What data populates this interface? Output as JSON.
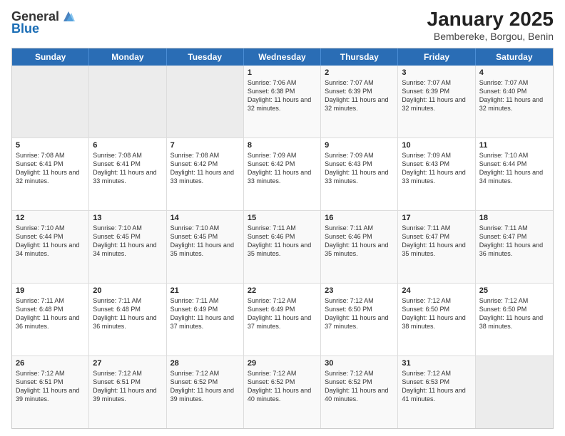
{
  "logo": {
    "general": "General",
    "blue": "Blue"
  },
  "header": {
    "month": "January 2025",
    "location": "Bembereke, Borgou, Benin"
  },
  "days": [
    "Sunday",
    "Monday",
    "Tuesday",
    "Wednesday",
    "Thursday",
    "Friday",
    "Saturday"
  ],
  "weeks": [
    [
      {
        "day": "",
        "sun": "",
        "mon": "",
        "rise": "",
        "set": "",
        "daylight": ""
      },
      {
        "day": "",
        "empty": true
      },
      {
        "day": "",
        "empty": true
      },
      {
        "day": "1",
        "rise": "Sunrise: 7:06 AM",
        "set": "Sunset: 6:38 PM",
        "daylight": "Daylight: 11 hours and 32 minutes."
      },
      {
        "day": "2",
        "rise": "Sunrise: 7:07 AM",
        "set": "Sunset: 6:39 PM",
        "daylight": "Daylight: 11 hours and 32 minutes."
      },
      {
        "day": "3",
        "rise": "Sunrise: 7:07 AM",
        "set": "Sunset: 6:39 PM",
        "daylight": "Daylight: 11 hours and 32 minutes."
      },
      {
        "day": "4",
        "rise": "Sunrise: 7:07 AM",
        "set": "Sunset: 6:40 PM",
        "daylight": "Daylight: 11 hours and 32 minutes."
      }
    ],
    [
      {
        "day": "5",
        "rise": "Sunrise: 7:08 AM",
        "set": "Sunset: 6:41 PM",
        "daylight": "Daylight: 11 hours and 32 minutes."
      },
      {
        "day": "6",
        "rise": "Sunrise: 7:08 AM",
        "set": "Sunset: 6:41 PM",
        "daylight": "Daylight: 11 hours and 33 minutes."
      },
      {
        "day": "7",
        "rise": "Sunrise: 7:08 AM",
        "set": "Sunset: 6:42 PM",
        "daylight": "Daylight: 11 hours and 33 minutes."
      },
      {
        "day": "8",
        "rise": "Sunrise: 7:09 AM",
        "set": "Sunset: 6:42 PM",
        "daylight": "Daylight: 11 hours and 33 minutes."
      },
      {
        "day": "9",
        "rise": "Sunrise: 7:09 AM",
        "set": "Sunset: 6:43 PM",
        "daylight": "Daylight: 11 hours and 33 minutes."
      },
      {
        "day": "10",
        "rise": "Sunrise: 7:09 AM",
        "set": "Sunset: 6:43 PM",
        "daylight": "Daylight: 11 hours and 33 minutes."
      },
      {
        "day": "11",
        "rise": "Sunrise: 7:10 AM",
        "set": "Sunset: 6:44 PM",
        "daylight": "Daylight: 11 hours and 34 minutes."
      }
    ],
    [
      {
        "day": "12",
        "rise": "Sunrise: 7:10 AM",
        "set": "Sunset: 6:44 PM",
        "daylight": "Daylight: 11 hours and 34 minutes."
      },
      {
        "day": "13",
        "rise": "Sunrise: 7:10 AM",
        "set": "Sunset: 6:45 PM",
        "daylight": "Daylight: 11 hours and 34 minutes."
      },
      {
        "day": "14",
        "rise": "Sunrise: 7:10 AM",
        "set": "Sunset: 6:45 PM",
        "daylight": "Daylight: 11 hours and 35 minutes."
      },
      {
        "day": "15",
        "rise": "Sunrise: 7:11 AM",
        "set": "Sunset: 6:46 PM",
        "daylight": "Daylight: 11 hours and 35 minutes."
      },
      {
        "day": "16",
        "rise": "Sunrise: 7:11 AM",
        "set": "Sunset: 6:46 PM",
        "daylight": "Daylight: 11 hours and 35 minutes."
      },
      {
        "day": "17",
        "rise": "Sunrise: 7:11 AM",
        "set": "Sunset: 6:47 PM",
        "daylight": "Daylight: 11 hours and 35 minutes."
      },
      {
        "day": "18",
        "rise": "Sunrise: 7:11 AM",
        "set": "Sunset: 6:47 PM",
        "daylight": "Daylight: 11 hours and 36 minutes."
      }
    ],
    [
      {
        "day": "19",
        "rise": "Sunrise: 7:11 AM",
        "set": "Sunset: 6:48 PM",
        "daylight": "Daylight: 11 hours and 36 minutes."
      },
      {
        "day": "20",
        "rise": "Sunrise: 7:11 AM",
        "set": "Sunset: 6:48 PM",
        "daylight": "Daylight: 11 hours and 36 minutes."
      },
      {
        "day": "21",
        "rise": "Sunrise: 7:11 AM",
        "set": "Sunset: 6:49 PM",
        "daylight": "Daylight: 11 hours and 37 minutes."
      },
      {
        "day": "22",
        "rise": "Sunrise: 7:12 AM",
        "set": "Sunset: 6:49 PM",
        "daylight": "Daylight: 11 hours and 37 minutes."
      },
      {
        "day": "23",
        "rise": "Sunrise: 7:12 AM",
        "set": "Sunset: 6:50 PM",
        "daylight": "Daylight: 11 hours and 37 minutes."
      },
      {
        "day": "24",
        "rise": "Sunrise: 7:12 AM",
        "set": "Sunset: 6:50 PM",
        "daylight": "Daylight: 11 hours and 38 minutes."
      },
      {
        "day": "25",
        "rise": "Sunrise: 7:12 AM",
        "set": "Sunset: 6:50 PM",
        "daylight": "Daylight: 11 hours and 38 minutes."
      }
    ],
    [
      {
        "day": "26",
        "rise": "Sunrise: 7:12 AM",
        "set": "Sunset: 6:51 PM",
        "daylight": "Daylight: 11 hours and 39 minutes."
      },
      {
        "day": "27",
        "rise": "Sunrise: 7:12 AM",
        "set": "Sunset: 6:51 PM",
        "daylight": "Daylight: 11 hours and 39 minutes."
      },
      {
        "day": "28",
        "rise": "Sunrise: 7:12 AM",
        "set": "Sunset: 6:52 PM",
        "daylight": "Daylight: 11 hours and 39 minutes."
      },
      {
        "day": "29",
        "rise": "Sunrise: 7:12 AM",
        "set": "Sunset: 6:52 PM",
        "daylight": "Daylight: 11 hours and 40 minutes."
      },
      {
        "day": "30",
        "rise": "Sunrise: 7:12 AM",
        "set": "Sunset: 6:52 PM",
        "daylight": "Daylight: 11 hours and 40 minutes."
      },
      {
        "day": "31",
        "rise": "Sunrise: 7:12 AM",
        "set": "Sunset: 6:53 PM",
        "daylight": "Daylight: 11 hours and 41 minutes."
      },
      {
        "day": "",
        "empty": true
      }
    ]
  ]
}
